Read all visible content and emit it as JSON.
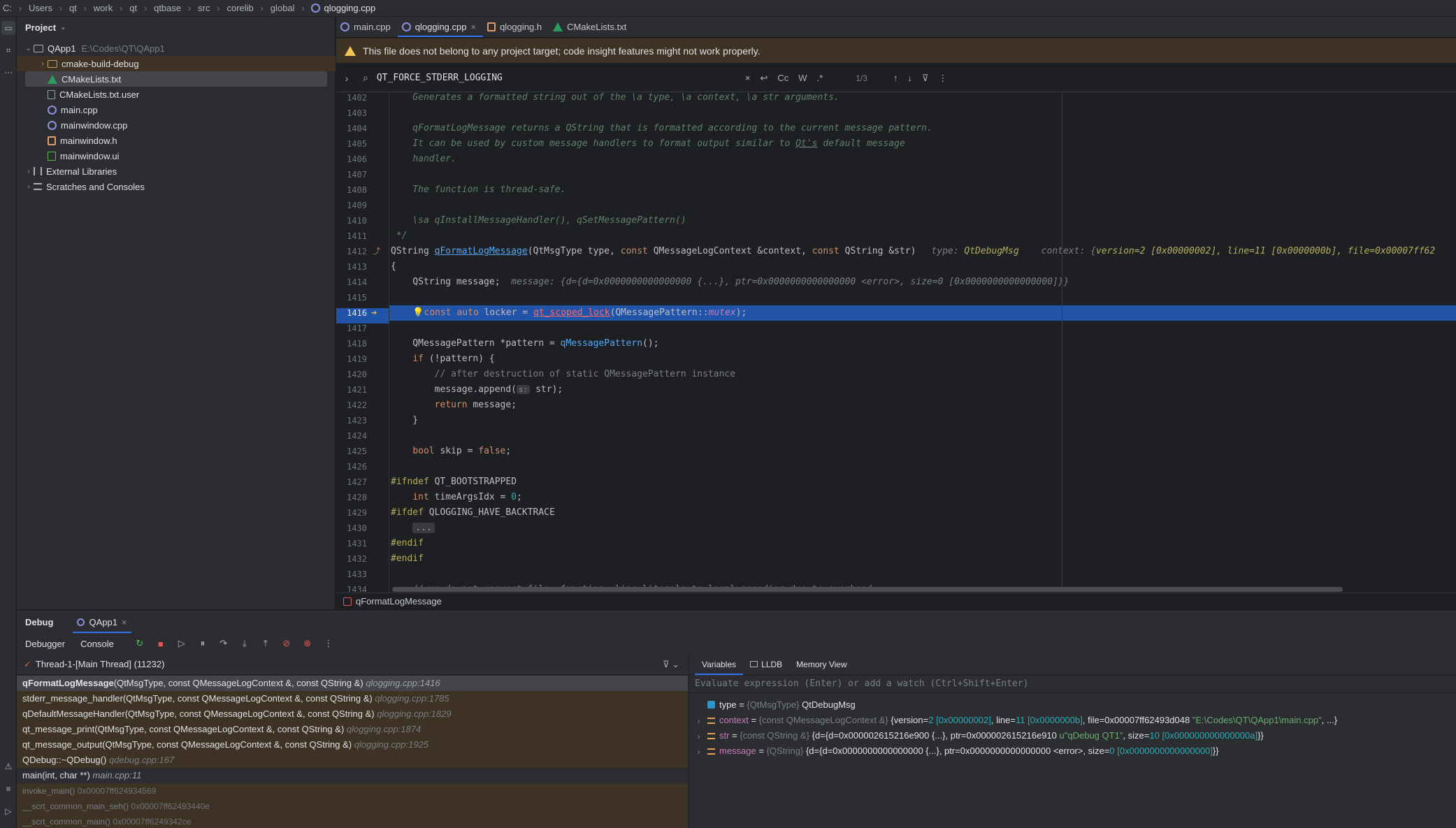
{
  "breadcrumb": {
    "items": [
      "C:",
      "Users",
      "qt",
      "work",
      "qt",
      "qtbase",
      "src",
      "corelib",
      "global"
    ],
    "current": "qlogging.cpp"
  },
  "project": {
    "header": "Project",
    "root_name": "QApp1",
    "root_path": "E:\\Codes\\QT\\QApp1",
    "items": [
      {
        "name": "cmake-build-debug"
      },
      {
        "name": "CMakeLists.txt"
      },
      {
        "name": "CMakeLists.txt.user"
      },
      {
        "name": "main.cpp"
      },
      {
        "name": "mainwindow.cpp"
      },
      {
        "name": "mainwindow.h"
      },
      {
        "name": "mainwindow.ui"
      }
    ],
    "external": "External Libraries",
    "scratches": "Scratches and Consoles"
  },
  "tabs": [
    {
      "label": "main.cpp"
    },
    {
      "label": "qlogging.cpp"
    },
    {
      "label": "qlogging.h"
    },
    {
      "label": "CMakeLists.txt"
    }
  ],
  "warning": "This file does not belong to any project target; code insight features might not work properly.",
  "find": {
    "query": "QT_FORCE_STDERR_LOGGING",
    "case_label": "Cc",
    "word_label": "W",
    "regex_label": ".*",
    "count": "1/3"
  },
  "code": {
    "lines": [
      {
        "n": "1402",
        "c": "    Generates a formatted string out of the \\a type, \\a context, \\a str arguments."
      },
      {
        "n": "1403",
        "c": ""
      },
      {
        "n": "1404",
        "c": "    qFormatLogMessage returns a QString that is formatted according to the current message pattern."
      },
      {
        "n": "1405",
        "c1": "    It can be used by custom message handlers to format output similar to ",
        "u": "Qt's",
        "c2": " default message"
      },
      {
        "n": "1406",
        "c": "    handler."
      },
      {
        "n": "1407",
        "c": ""
      },
      {
        "n": "1408",
        "c": "    The function is thread-safe."
      },
      {
        "n": "1409",
        "c": ""
      },
      {
        "n": "1410",
        "c": "    \\sa qInstallMessageHandler(), qSetMessagePattern()"
      },
      {
        "n": "1411",
        "c": " */"
      },
      {
        "n": "1412"
      },
      {
        "n": "1413",
        "c": "{"
      },
      {
        "n": "1414"
      },
      {
        "n": "1415",
        "c": ""
      },
      {
        "n": "1416"
      },
      {
        "n": "1417",
        "c": ""
      },
      {
        "n": "1418"
      },
      {
        "n": "1419"
      },
      {
        "n": "1420",
        "c": "        // after destruction of static QMessagePattern instance"
      },
      {
        "n": "1421"
      },
      {
        "n": "1422"
      },
      {
        "n": "1423",
        "c": "    }"
      },
      {
        "n": "1424",
        "c": ""
      },
      {
        "n": "1425"
      },
      {
        "n": "1426",
        "c": ""
      },
      {
        "n": "1427"
      },
      {
        "n": "1428"
      },
      {
        "n": "1429"
      },
      {
        "n": "1430",
        "c": "..."
      },
      {
        "n": "1431",
        "c": "#endif"
      },
      {
        "n": "1432",
        "c": "#endif"
      },
      {
        "n": "1433",
        "c": ""
      },
      {
        "n": "1434",
        "c": "    // we do not convert file, function, line literals to local encoding due to overhead"
      }
    ],
    "sig": {
      "ret": "QString ",
      "fn": "qFormatLogMessage",
      "args": "(QtMsgType type, ",
      "kw1": "const",
      "a2": " QMessageLogContext &context, ",
      "kw2": "const",
      "a3": " QString &str)",
      "hint1": "type: ",
      "hint1v": "QtDebugMsg",
      "hint2": "context: {",
      "hint2v": "version=2 [0x00000002], line=11 [0x0000000b], file=0x00007ff62"
    },
    "l1414": {
      "pre": "    QString message;",
      "hint": "  message: {d={d=0x0000000000000000 {...}, ptr=0x0000000000000000 <error>, size=0 [0x0000000000000000]}}"
    },
    "l1416": {
      "kw1": "const",
      "kw2": "auto",
      "mid": " locker = ",
      "call": "qt_scoped_lock",
      "open": "(QMessagePattern::",
      "st": "mutex",
      "close": ");"
    },
    "l1418": {
      "pre": "    QMessagePattern *pattern = ",
      "fn": "qMessagePattern",
      "post": "();"
    },
    "l1419": {
      "kw": "if",
      "post": " (!pattern) {"
    },
    "l1421": {
      "pre": "        message.append(",
      "inlay": "s:",
      "post": " str);"
    },
    "l1422": {
      "kw": "return",
      "post": " message;"
    },
    "l1425": {
      "kw": "bool",
      "mid": " skip = ",
      "kw2": "false",
      "post": ";"
    },
    "l1427": {
      "kw": "#ifndef",
      "post": " QT_BOOTSTRAPPED"
    },
    "l1428": {
      "kw": "int",
      "mid": " timeArgsIdx = ",
      "num": "0",
      "post": ";"
    },
    "l1429": {
      "kw": "#ifdef",
      "post": " QLOGGING_HAVE_BACKTRACE"
    }
  },
  "editor_crumb": "qFormatLogMessage",
  "debug": {
    "title": "Debug",
    "session": "QApp1",
    "debugger_tab": "Debugger",
    "console_tab": "Console",
    "thread": "Thread-1-[Main Thread] (11232)",
    "frames": [
      {
        "name": "qFormatLogMessage",
        "args": "(QtMsgType, const QMessageLogContext &, const QString &)",
        "loc": "qlogging.cpp:1416"
      },
      {
        "name": "stderr_message_handler",
        "args": "(QtMsgType, const QMessageLogContext &, const QString &)",
        "loc": "qlogging.cpp:1785"
      },
      {
        "name": "qDefaultMessageHandler",
        "args": "(QtMsgType, const QMessageLogContext &, const QString &)",
        "loc": "qlogging.cpp:1829"
      },
      {
        "name": "qt_message_print",
        "args": "(QtMsgType, const QMessageLogContext &, const QString &)",
        "loc": "qlogging.cpp:1874"
      },
      {
        "name": "qt_message_output",
        "args": "(QtMsgType, const QMessageLogContext &, const QString &)",
        "loc": "qlogging.cpp:1925"
      },
      {
        "name": "QDebug::~QDebug",
        "args": "()",
        "loc": "qdebug.cpp:167"
      },
      {
        "name": "main",
        "args": "(int, char **)",
        "loc": "main.cpp:11"
      },
      {
        "name": "invoke_main",
        "args": "()",
        "loc": "0x00007ff624934569"
      },
      {
        "name": "__scrt_common_main_seh",
        "args": "()",
        "loc": "0x00007ff62493440e"
      },
      {
        "name": "__scrt_common_main",
        "args": "()",
        "loc": "0x00007ff6249342ce"
      }
    ],
    "vars_tabs": {
      "variables": "Variables",
      "lldb": "LLDB",
      "memory": "Memory View"
    },
    "watch_placeholder": "Evaluate expression (Enter) or add a watch (Ctrl+Shift+Enter)",
    "vars": {
      "type": {
        "name": "type",
        "eq": " = ",
        "t": "{QtMsgType}",
        "v": " QtDebugMsg"
      },
      "context": {
        "name": "context",
        "eq": " = ",
        "t": "{const QMessageLogContext &}",
        "v1": " {version=",
        "n1": "2",
        "v2": " ",
        "h1": "[0x00000002]",
        "v3": ", line=",
        "n2": "11",
        "v4": " ",
        "h2": "[0x0000000b]",
        "v5": ", file=0x00007ff62493d048 ",
        "s": "\"E:\\Codes\\QT\\QApp1\\main.cpp\"",
        "v6": ", ...}"
      },
      "str": {
        "name": "str",
        "eq": " = ",
        "t": "{const QString &}",
        "v1": " {d={d=0x000002615216e900 {...}, ptr=0x000002615216e910 ",
        "s": "u\"qDebug QT1\"",
        "v2": ", size=",
        "n": "10",
        "v3": " ",
        "h": "[0x000000000000000a]",
        "v4": "}}"
      },
      "message": {
        "name": "message",
        "eq": " = ",
        "t": "{QString}",
        "v1": " {d={d=0x0000000000000000 {...}, ptr=0x0000000000000000 <error>, size=",
        "n": "0",
        "v2": " ",
        "h": "[0x0000000000000000]",
        "v3": "}}"
      }
    }
  }
}
